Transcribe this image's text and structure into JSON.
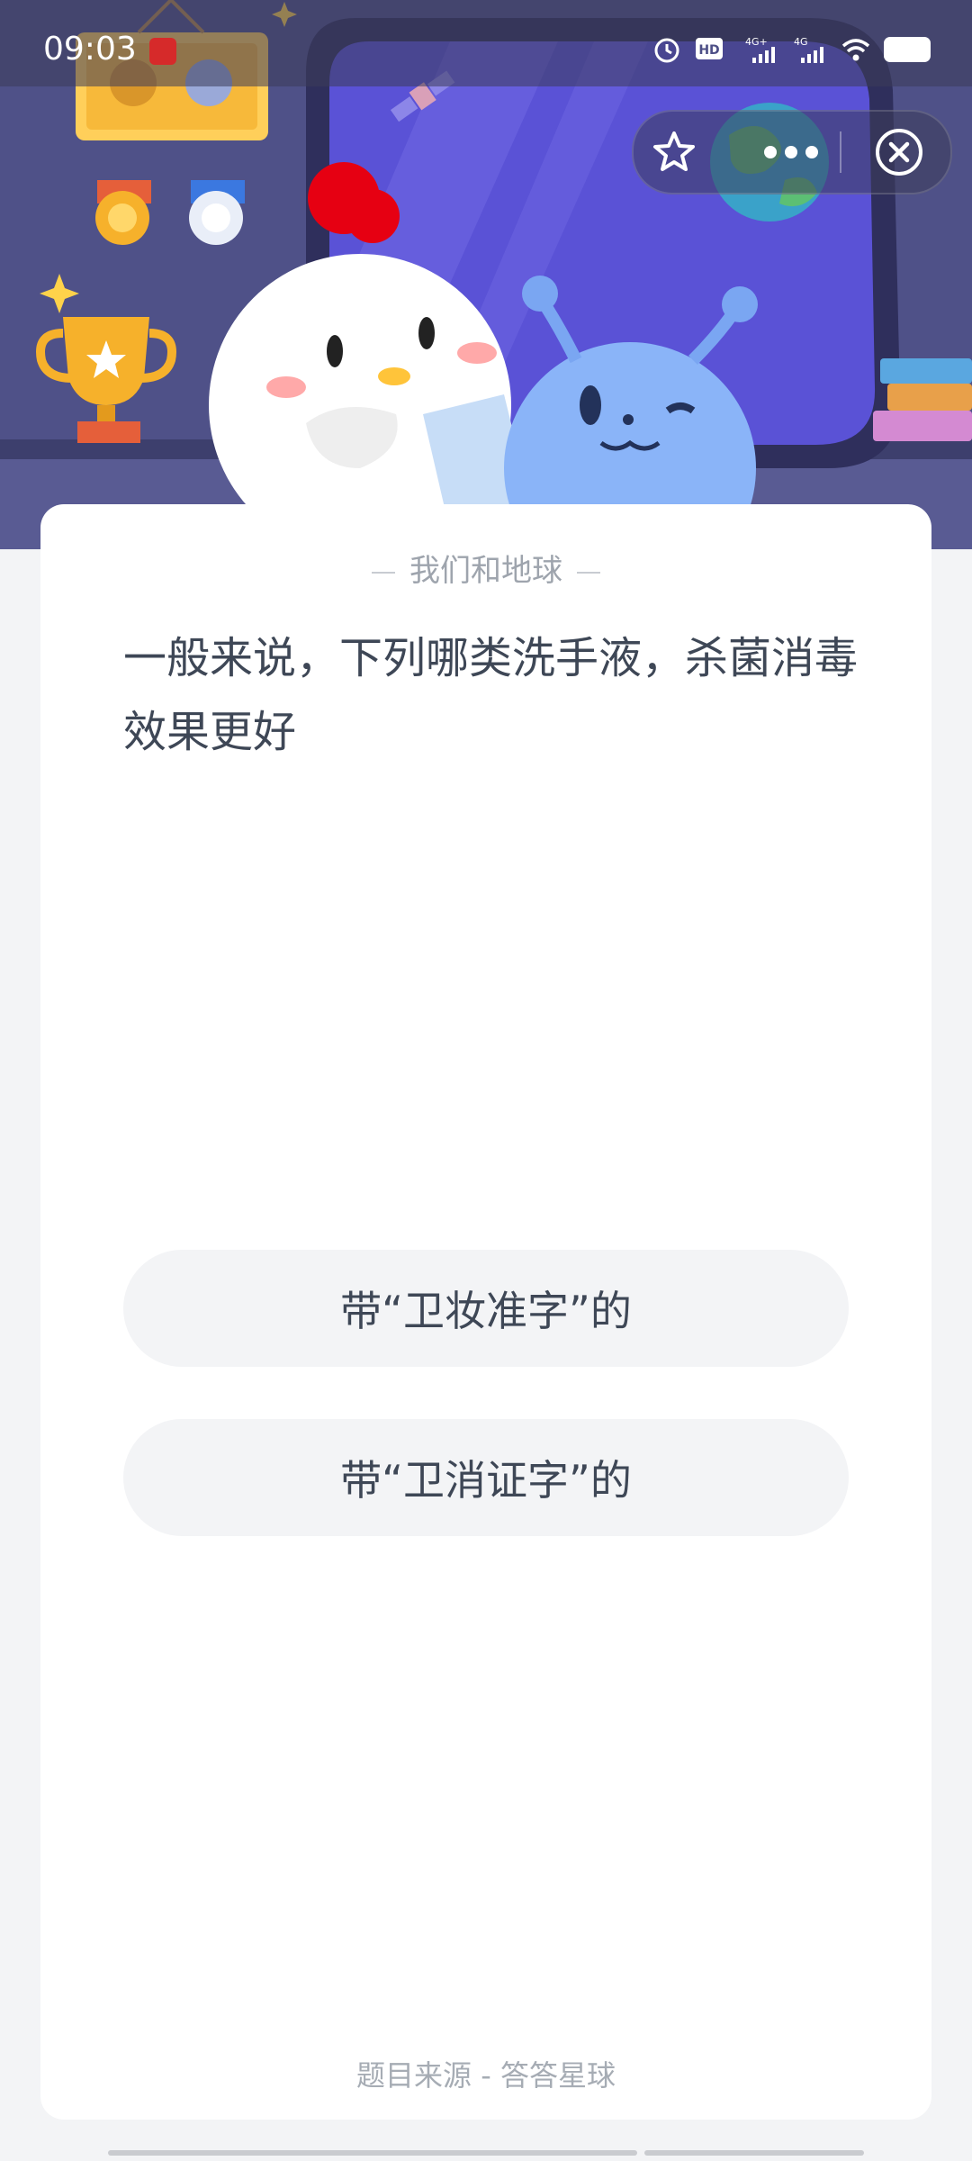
{
  "status_bar": {
    "time": "09:03",
    "network_1": "4G+",
    "network_2": "4G",
    "hd_label": "HD"
  },
  "capsule": {
    "favorite_icon": "star-icon",
    "more_icon": "more-dots-icon",
    "close_icon": "close-circle-icon"
  },
  "card": {
    "category": "我们和地球",
    "question": "一般来说，下列哪类洗手液，杀菌消毒效果更好",
    "options": [
      "带“卫妆准字”的",
      "带“卫消证字”的"
    ],
    "source": "题目来源 - 答答星球"
  },
  "colors": {
    "hero_bg": "#4d4f86",
    "card_bg": "#ffffff",
    "option_bg": "#f3f4f6",
    "question_text": "#3e4756",
    "muted_text": "#9ea4ad"
  }
}
